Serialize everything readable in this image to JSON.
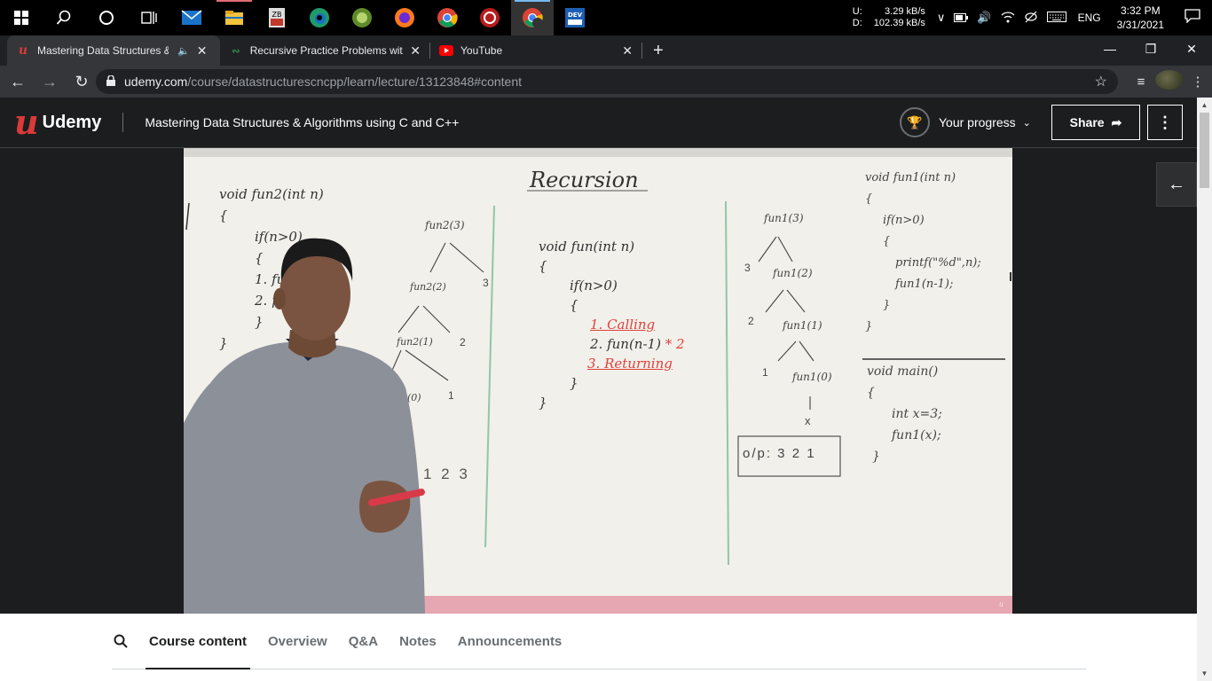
{
  "taskbar": {
    "icons": [
      {
        "name": "windows-start-icon",
        "state": ""
      },
      {
        "name": "search-icon",
        "state": ""
      },
      {
        "name": "cortana-icon",
        "state": ""
      },
      {
        "name": "task-view-icon",
        "state": ""
      },
      {
        "name": "mail-icon",
        "state": ""
      },
      {
        "name": "file-explorer-icon",
        "state": ""
      },
      {
        "name": "media-app-icon",
        "state": ""
      },
      {
        "name": "edge-icon",
        "state": ""
      },
      {
        "name": "game-app-icon",
        "state": ""
      },
      {
        "name": "firefox-icon",
        "state": ""
      },
      {
        "name": "chrome-icon",
        "state": ""
      },
      {
        "name": "red-app-icon",
        "state": ""
      },
      {
        "name": "chrome-profile-icon",
        "state": "active"
      },
      {
        "name": "dev-app-icon",
        "state": ""
      }
    ],
    "network": {
      "up_label": "U:",
      "up_value": "3.29 kB/s",
      "down_label": "D:",
      "down_value": "102.39 kB/s"
    },
    "language": "ENG",
    "time": "3:32 PM",
    "date": "3/31/2021"
  },
  "browser": {
    "tabs": [
      {
        "title": "Mastering Data Structures &",
        "active": true
      },
      {
        "title": "Recursive Practice Problems with",
        "active": false
      },
      {
        "title": "YouTube",
        "active": false
      }
    ],
    "url_host": "udemy.com",
    "url_path": "/course/datastructurescncpp/learn/lecture/13123848#content"
  },
  "udemy": {
    "logo_text": "Udemy",
    "course_title": "Mastering Data Structures & Algorithms using C and C++",
    "progress_label": "Your progress",
    "share_label": "Share",
    "accent": "#a435f0",
    "brand_red": "#d93a3a"
  },
  "whiteboard": {
    "title": "Recursion",
    "left_code": [
      "void fun2(int n)",
      "{",
      "if(n>0)",
      "{",
      "1. fun",
      "2. prin",
      "}",
      "}"
    ],
    "left_tree": [
      "fun2(3)",
      "fun2(2)",
      "3",
      "fun2(1)",
      "2",
      "2(0)",
      "1"
    ],
    "left_output": "1 2 3",
    "middle_code": [
      "void fun(int n)",
      "{",
      "if(n>0)",
      "{",
      "1. Calling",
      "2. fun(n-1)",
      "* 2",
      "3. Returning",
      "}",
      "}"
    ],
    "right_tree": [
      "fun1(3)",
      "3",
      "fun1(2)",
      "2",
      "fun1(1)",
      "1",
      "fun1(0)",
      "x"
    ],
    "right_output": "o/p: 3 2 1",
    "right_code": [
      "void fun1(int n)",
      "{",
      "if(n>0)",
      "{",
      "printf(\"%d\",n);",
      "fun1(n-1);",
      "}",
      "}"
    ],
    "main_code": [
      "void main()",
      "{",
      "int x=3;",
      "fun1(x);",
      "}"
    ]
  },
  "bottom_tabs": [
    "Course content",
    "Overview",
    "Q&A",
    "Notes",
    "Announcements"
  ]
}
